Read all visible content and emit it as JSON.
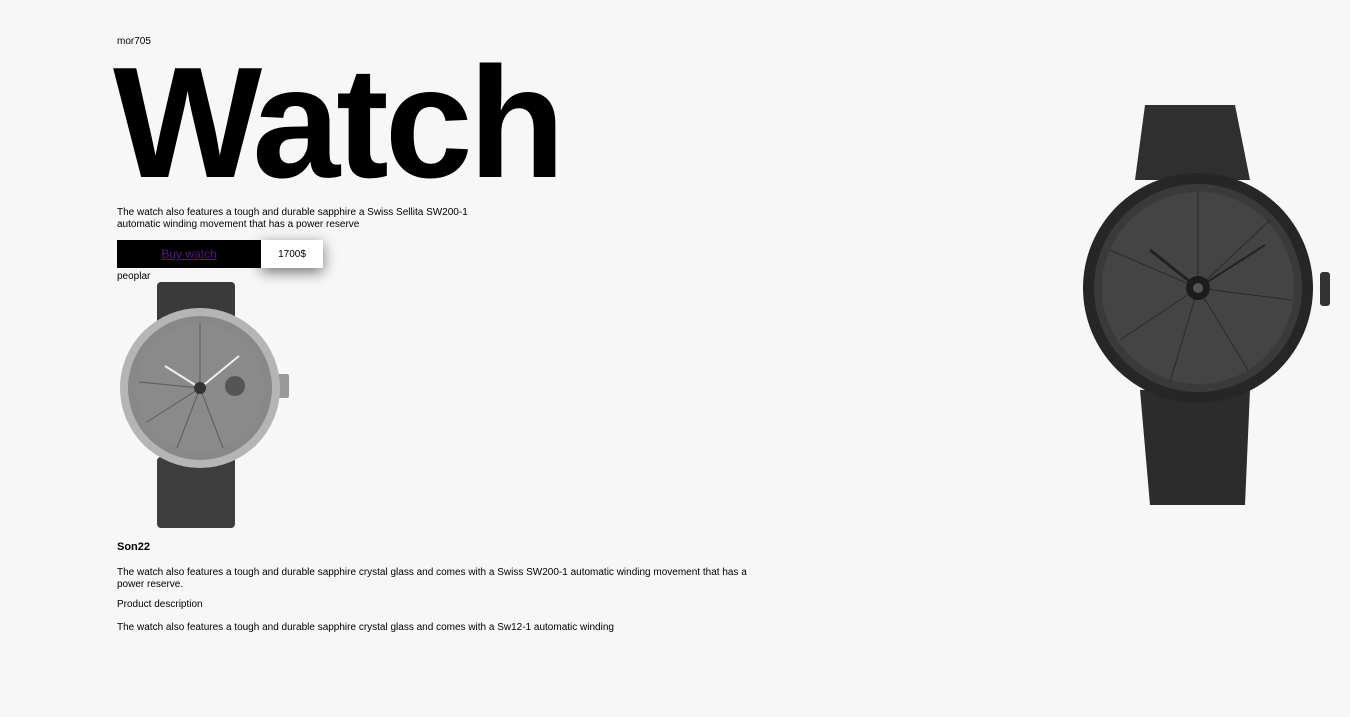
{
  "brand": "mor705",
  "hero": {
    "title": "Watch",
    "description": "The watch also features a tough and durable sapphire a Swiss Sellita SW200-1 automatic winding movement that has a power reserve",
    "buy_label": "Buy watch",
    "price": "1700$"
  },
  "popular": {
    "label": "peoplar",
    "product_name": "Son22",
    "product_text": "The watch also features a tough and durable sapphire crystal glass and comes with a Swiss SW200-1 automatic winding movement that has a power reserve.",
    "description_label": "Product description",
    "description_text": "The watch also features a tough and durable sapphire crystal glass and comes with a Sw12-1 automatic winding"
  },
  "colors": {
    "background": "#f7f7f7",
    "button": "#000000",
    "link": "#551a8b"
  }
}
